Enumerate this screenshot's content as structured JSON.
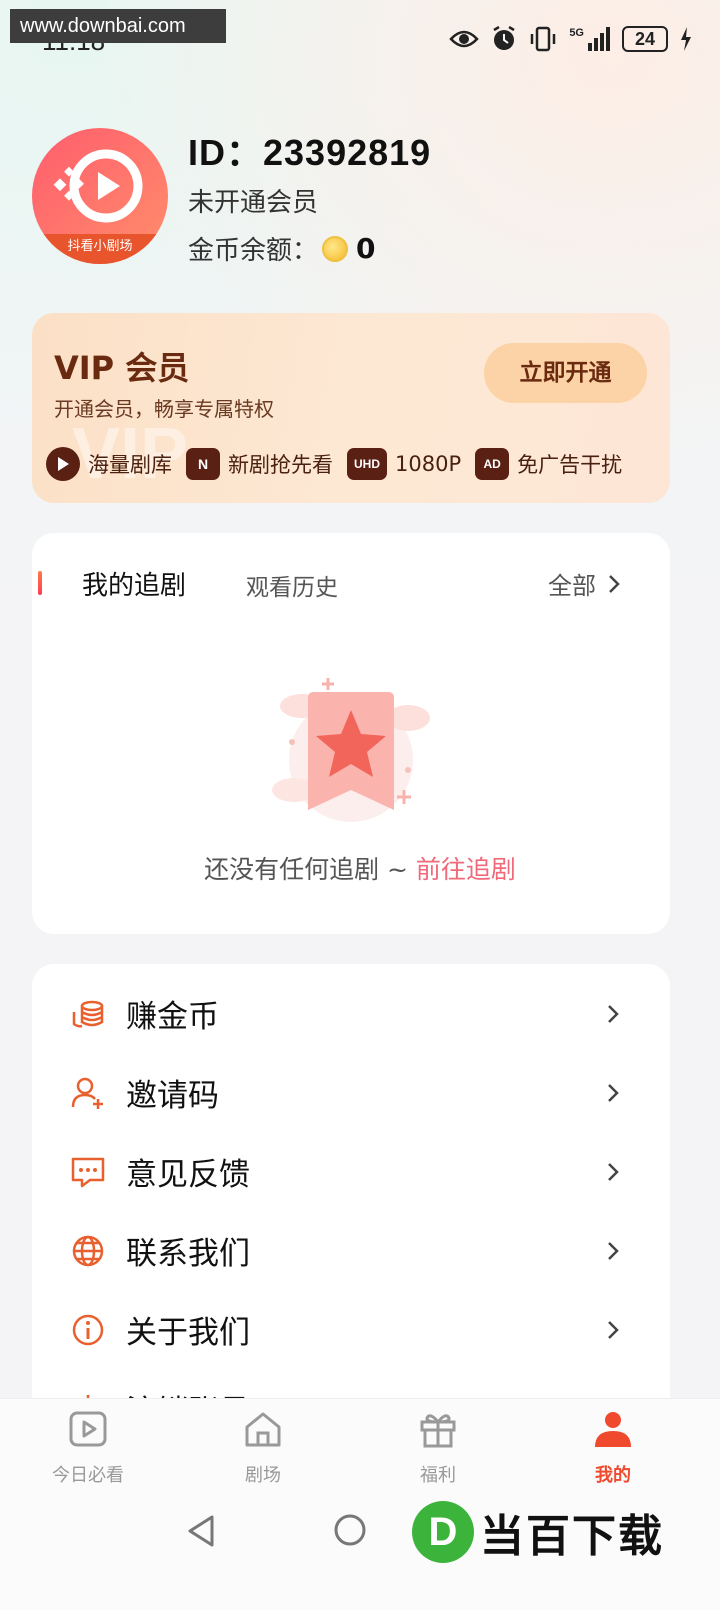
{
  "status_bar": {
    "watermark": "www.downbai.com",
    "time": "11:18",
    "network": "5G",
    "battery": "24"
  },
  "profile": {
    "avatar_caption": "抖看小剧场",
    "id_text": "ID：23392819",
    "member_status": "未开通会员",
    "coin_label": "金币余额：",
    "coin_value": "0"
  },
  "vip": {
    "title": "VIP 会员",
    "subtitle": "开通会员，畅享专属特权",
    "button": "立即开通",
    "perks": [
      {
        "icon": "play-icon",
        "label": "海量剧库"
      },
      {
        "icon": "new-drama-icon",
        "icon_text": "N",
        "label": "新剧抢先看"
      },
      {
        "icon": "uhd-icon",
        "icon_text": "UHD",
        "label": "1080P"
      },
      {
        "icon": "no-ad-icon",
        "icon_text": "AD",
        "label": "免广告干扰"
      }
    ]
  },
  "drama": {
    "tab_active": "我的追剧",
    "tab_other": "观看历史",
    "all_label": "全部",
    "empty_text": "还没有任何追剧 ~ ",
    "empty_link": "前往追剧"
  },
  "menu": [
    {
      "icon": "coins-icon",
      "label": "赚金币"
    },
    {
      "icon": "add-user-icon",
      "label": "邀请码"
    },
    {
      "icon": "feedback-icon",
      "label": "意见反馈"
    },
    {
      "icon": "globe-icon",
      "label": "联系我们"
    },
    {
      "icon": "info-icon",
      "label": "关于我们"
    },
    {
      "icon": "logout-icon",
      "label": "注销账号"
    }
  ],
  "bottom_nav": [
    {
      "icon": "play-square-icon",
      "label": "今日必看",
      "active": false
    },
    {
      "icon": "home-icon",
      "label": "剧场",
      "active": false
    },
    {
      "icon": "gift-icon",
      "label": "福利",
      "active": false
    },
    {
      "icon": "profile-icon",
      "label": "我的",
      "active": true
    }
  ],
  "brand": {
    "logo_letter": "D",
    "text": "当百下载"
  },
  "colors": {
    "accent": "#f04a2e",
    "vip_dark": "#6a2a10",
    "link": "#f06a7a"
  }
}
